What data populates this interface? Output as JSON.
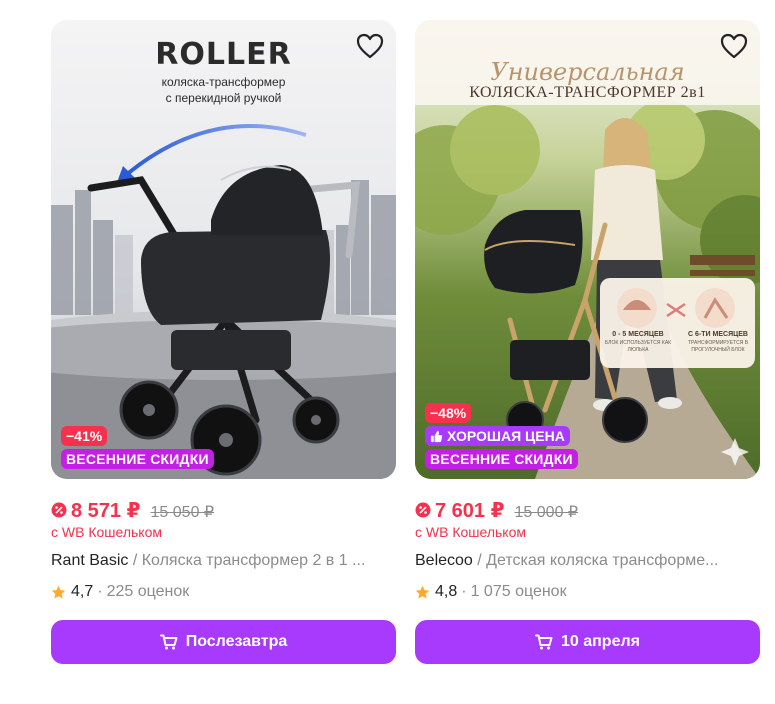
{
  "colors": {
    "accent": "#a73afd",
    "sale_red": "#f5314e",
    "promo_magenta": "#c41fe5"
  },
  "products": [
    {
      "image": {
        "brand_logo": "ROLLER",
        "subtitle_line1": "коляска-трансформер",
        "subtitle_line2": "с перекидной ручкой"
      },
      "favorite_icon": "heart-outline-icon",
      "discount_badge": "−41%",
      "promo_badge": "ВЕСЕННИЕ СКИДКИ",
      "price": "8 571 ₽",
      "old_price": "15 050 ₽",
      "wallet_note": "с WB Кошельком",
      "brand": "Rant Basic",
      "separator": " / ",
      "name": "Коляска трансформер 2 в 1 ...",
      "rating": "4,7",
      "dot": "·",
      "reviews": "225 оценок",
      "cta_label": "Послезавтра",
      "cta_icon": "cart-icon"
    },
    {
      "image": {
        "headline_script": "Универсальная",
        "headline_caps": "КОЛЯСКА-ТРАНСФОРМЕР 2в1",
        "info_left_title": "0 - 5 МЕСЯЦЕВ",
        "info_left_text": "БЛОК ИСПОЛЬЗУЕТСЯ КАК ЛЮЛЬКА",
        "info_right_title": "С 6-ТИ МЕСЯЦЕВ",
        "info_right_text": "ТРАНСФОРМИРУЕТСЯ В ПРОГУЛОЧНЫЙ БЛОК"
      },
      "favorite_icon": "heart-outline-icon",
      "discount_badge": "−48%",
      "good_badge": "ХОРОШАЯ ЦЕНА",
      "promo_badge": "ВЕСЕННИЕ СКИДКИ",
      "price": "7 601 ₽",
      "old_price": "15 000 ₽",
      "wallet_note": "с WB Кошельком",
      "brand": "Belecoo",
      "separator": " / ",
      "name": "Детская коляска трансформе...",
      "rating": "4,8",
      "dot": "·",
      "reviews": "1 075 оценок",
      "cta_label": "10 апреля",
      "cta_icon": "cart-icon"
    }
  ]
}
